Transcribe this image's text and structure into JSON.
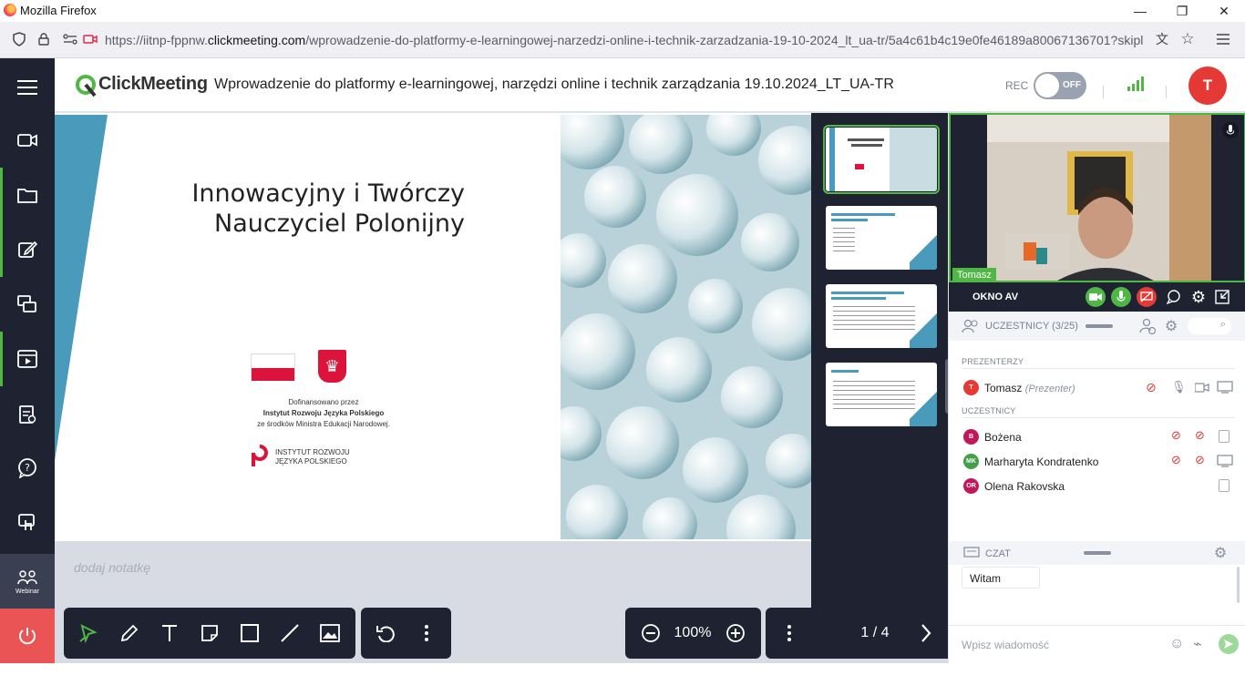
{
  "browser": {
    "window_title": "Mozilla Firefox",
    "url_prefix": "https://iitnp-fppnw.",
    "url_domain": "clickmeeting.com",
    "url_path": "/wprowadzenie-do-platformy-e-learningowej-narzedzi-online-i-technik-zarzadzania-19-10-2024_lt_ua-tr/5a4c61b4c19e0fe46189a80067136701?skipl"
  },
  "header": {
    "logo": "ClickMeeting",
    "meeting_title": "Wprowadzenie do platformy e-learningowej, narzędzi online i technik zarządzania 19.10.2024_LT_UA-TR",
    "rec_label": "REC",
    "rec_state": "OFF",
    "user_initial": "T"
  },
  "nav": {
    "webinar_label": "Webinar",
    "items": [
      "menu-icon",
      "video-icon",
      "folder-icon",
      "edit-icon",
      "screen-share-icon",
      "media-icon",
      "tests-icon",
      "qa-icon",
      "touch-icon"
    ]
  },
  "slide": {
    "title_line1": "Innowacyjny i Twórczy",
    "title_line2": "Nauczyciel Polonijny",
    "fund_line1": "Dofinansowano przez",
    "fund_line2": "Instytut Rozwoju Języka Polskiego",
    "fund_line3": "ze środków Ministra Edukacji Narodowej.",
    "inst_line1": "INSTYTUT ROZWOJU",
    "inst_line2": "JĘZYKA POLSKIEGO"
  },
  "note_placeholder": "dodaj notatkę",
  "zoom": "100%",
  "page": "1 / 4",
  "video": {
    "name": "Tomasz",
    "panel_title": "OKNO AV"
  },
  "participants": {
    "title": "UCZESTNICY (3/25)",
    "presenters_label": "PREZENTERZY",
    "attendees_label": "UCZESTNICY",
    "presenter": {
      "initials": "T",
      "name": "Tomasz",
      "role": "(Prezenter)",
      "color": "#e53935"
    },
    "list": [
      {
        "initials": "B",
        "name": "Bożena",
        "color": "#c2185b"
      },
      {
        "initials": "MK",
        "name": "Marharyta Kondratenko",
        "color": "#43a047"
      },
      {
        "initials": "OR",
        "name": "Olena Rakovska",
        "color": "#c2185b"
      }
    ]
  },
  "chat": {
    "title": "CZAT",
    "message": "Witam",
    "input_placeholder": "Wpisz wiadomość"
  },
  "colors": {
    "accent": "#4fb845",
    "dark": "#1f2331",
    "danger": "#e53935"
  }
}
